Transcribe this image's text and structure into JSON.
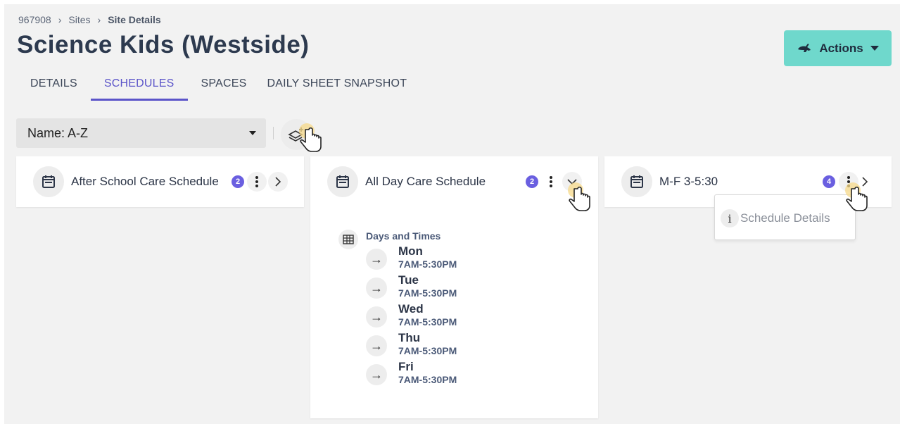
{
  "breadcrumb": {
    "root": "967908",
    "sites": "Sites",
    "current": "Site Details"
  },
  "page_title": "Science Kids (Westside)",
  "actions_label": "Actions",
  "tabs": [
    {
      "label": "DETAILS"
    },
    {
      "label": "SCHEDULES"
    },
    {
      "label": "SPACES"
    },
    {
      "label": "DAILY SHEET SNAPSHOT"
    }
  ],
  "active_tab": "SCHEDULES",
  "sort": {
    "label": "Name: A-Z"
  },
  "cards": [
    {
      "name": "After School Care Schedule",
      "count": "2"
    },
    {
      "name": "All Day Care Schedule",
      "count": "2"
    },
    {
      "name": "M-F 3-5:30",
      "count": "4"
    }
  ],
  "days_times": {
    "title": "Days and Times",
    "days": [
      {
        "day": "Mon",
        "time": "7AM-5:30PM"
      },
      {
        "day": "Tue",
        "time": "7AM-5:30PM"
      },
      {
        "day": "Wed",
        "time": "7AM-5:30PM"
      },
      {
        "day": "Thu",
        "time": "7AM-5:30PM"
      },
      {
        "day": "Fri",
        "time": "7AM-5:30PM"
      }
    ]
  },
  "context_menu": {
    "item": "Schedule Details",
    "icon": "i"
  },
  "colors": {
    "accent": "#5b54c9",
    "badge": "#6a5fe0",
    "actions_bg": "#6fd8cc",
    "page_bg": "#f2f2f2"
  }
}
